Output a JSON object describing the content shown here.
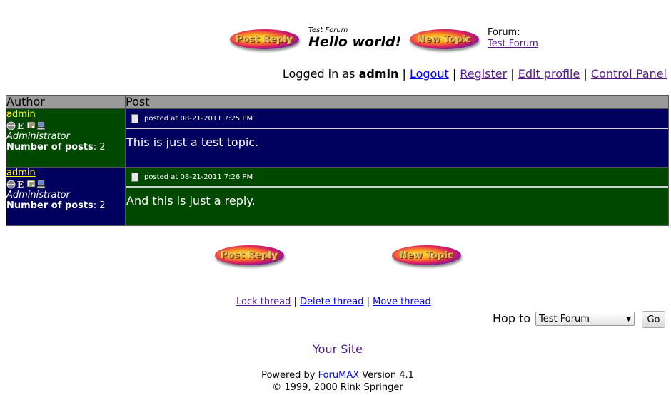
{
  "header": {
    "post_reply_label": "Post Reply",
    "new_topic_label": "New Topic",
    "topic_forum": "Test Forum",
    "topic_title": "Hello world!",
    "forum_label": "Forum:",
    "forum_link": "Test Forum"
  },
  "userbar": {
    "logged_in_as": "Logged in as",
    "username": "admin",
    "logout": "Logout",
    "register": "Register",
    "edit_profile": "Edit profile",
    "control_panel": "Control Panel"
  },
  "table": {
    "col_author": "Author",
    "col_post": "Post",
    "posts": [
      {
        "author": "admin",
        "role": "Administrator",
        "posts_label": "Number of posts",
        "posts_count": ": 2",
        "posted_at": "posted at 08-21-2011 7:25 PM",
        "body": "This is just a test topic."
      },
      {
        "author": "admin",
        "role": "Administrator",
        "posts_label": "Number of posts",
        "posts_count": ": 2",
        "posted_at": "posted at 08-21-2011 7:26 PM",
        "body": "And this is just a reply."
      }
    ]
  },
  "footer_buttons": {
    "post_reply_label": "Post Reply",
    "new_topic_label": "New Topic"
  },
  "moderation": {
    "lock": "Lock thread",
    "delete": "Delete thread",
    "move": "Move thread"
  },
  "hop": {
    "label": "Hop to",
    "selected": "Test Forum",
    "go": "Go"
  },
  "site_link": "Your Site",
  "powered": {
    "prefix": "Powered by",
    "product": "ForuMAX",
    "version": "Version 4.1",
    "copyright": "© 1999, 2000 Rink Springer"
  },
  "colors": {
    "author_col_green": "#004800",
    "author_col_navy": "#00005e",
    "username_link": "#ffff00",
    "header_gray": "#9a9a9a"
  }
}
